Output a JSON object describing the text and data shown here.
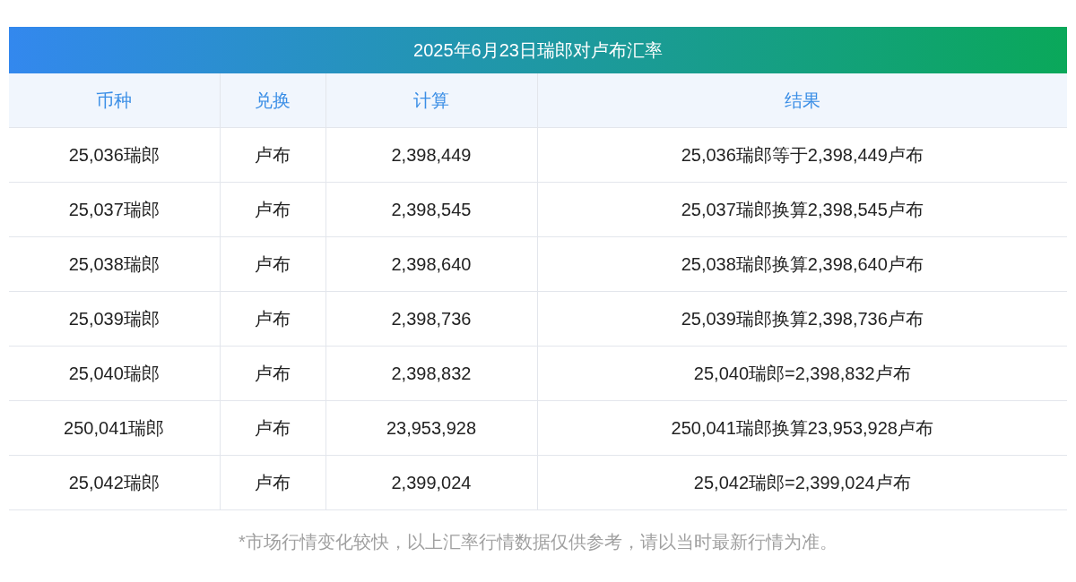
{
  "title": "2025年6月23日瑞郎对卢布汇率",
  "table": {
    "columns": [
      "币种",
      "兑换",
      "计算",
      "结果"
    ],
    "rows": [
      [
        "25,036瑞郎",
        "卢布",
        "2,398,449",
        "25,036瑞郎等于2,398,449卢布"
      ],
      [
        "25,037瑞郎",
        "卢布",
        "2,398,545",
        "25,037瑞郎换算2,398,545卢布"
      ],
      [
        "25,038瑞郎",
        "卢布",
        "2,398,640",
        "25,038瑞郎换算2,398,640卢布"
      ],
      [
        "25,039瑞郎",
        "卢布",
        "2,398,736",
        "25,039瑞郎换算2,398,736卢布"
      ],
      [
        "25,040瑞郎",
        "卢布",
        "2,398,832",
        "25,040瑞郎=2,398,832卢布"
      ],
      [
        "250,041瑞郎",
        "卢布",
        "23,953,928",
        "250,041瑞郎换算23,953,928卢布"
      ],
      [
        "25,042瑞郎",
        "卢布",
        "2,399,024",
        "25,042瑞郎=2,399,024卢布"
      ]
    ]
  },
  "footnote": "*市场行情变化较快，以上汇率行情数据仅供参考，请以当时最新行情为准。"
}
